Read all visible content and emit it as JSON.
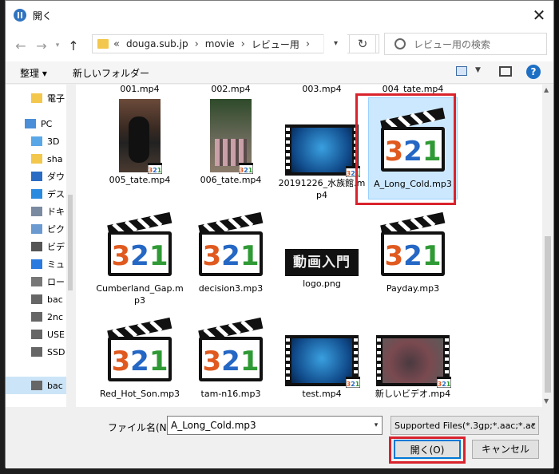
{
  "window": {
    "title": "開く"
  },
  "nav": {
    "back": "←",
    "forward": "→",
    "up": "↑",
    "breadcrumb_prefix": "«",
    "breadcrumb": [
      "douga.sub.jp",
      "movie",
      "レビュー用"
    ],
    "refresh": "↻",
    "search_placeholder": "レビュー用の検索"
  },
  "toolbar": {
    "organize": "整理 ▾",
    "new_folder": "新しいフォルダー",
    "help": "?"
  },
  "sidebar": {
    "items": [
      {
        "label": "電子",
        "icon": "folder-icon"
      },
      {
        "label": "PC",
        "icon": "pc-icon"
      },
      {
        "label": "3D",
        "icon": "3d-objects-icon"
      },
      {
        "label": "sha",
        "icon": "user-folder-icon"
      },
      {
        "label": "ダウ",
        "icon": "download-icon"
      },
      {
        "label": "デス",
        "icon": "desktop-icon"
      },
      {
        "label": "ドキ",
        "icon": "documents-icon"
      },
      {
        "label": "ピク",
        "icon": "pictures-icon"
      },
      {
        "label": "ビデ",
        "icon": "videos-icon"
      },
      {
        "label": "ミュ",
        "icon": "music-icon"
      },
      {
        "label": "ロー",
        "icon": "local-disk-icon"
      },
      {
        "label": "bac",
        "icon": "drive-icon"
      },
      {
        "label": "2nc",
        "icon": "drive-icon"
      },
      {
        "label": "USE",
        "icon": "drive-icon"
      },
      {
        "label": "SSD",
        "icon": "drive-icon"
      },
      {
        "label": "bac",
        "icon": "drive-icon"
      }
    ]
  },
  "files": {
    "top_row": [
      "001.mp4",
      "002.mp4",
      "003.mp4",
      "004_tate.mp4"
    ],
    "items": [
      {
        "name": "005_tate.mp4",
        "kind": "video-portrait"
      },
      {
        "name": "006_tate.mp4",
        "kind": "video-portrait-people"
      },
      {
        "name": "20191226_水族館.mp4",
        "kind": "video-aquarium"
      },
      {
        "name": "A_Long_Cold.mp3",
        "kind": "audio"
      },
      {
        "name": "Cumberland_Gap.mp3",
        "kind": "audio"
      },
      {
        "name": "decision3.mp3",
        "kind": "audio"
      },
      {
        "name": "logo.png",
        "kind": "image-logo"
      },
      {
        "name": "Payday.mp3",
        "kind": "audio"
      },
      {
        "name": "Red_Hot_Son.mp3",
        "kind": "audio"
      },
      {
        "name": "tam-n16.mp3",
        "kind": "audio"
      },
      {
        "name": "test.mp4",
        "kind": "video-aquarium"
      },
      {
        "name": "新しいビデオ.mp4",
        "kind": "video-bird"
      }
    ],
    "audio_icon_text": "321",
    "logo_text": "動画入門"
  },
  "footer": {
    "filename_label": "ファイル名(N):",
    "filename_value": "A_Long_Cold.mp3",
    "filter_value": "Supported Files(*.3gp;*.aac;*.ac",
    "open_label": "開く(O)",
    "cancel_label": "キャンセル"
  },
  "colors": {
    "accent": "#0078d7",
    "highlight": "#d9232d",
    "selection": "#cce8ff"
  }
}
